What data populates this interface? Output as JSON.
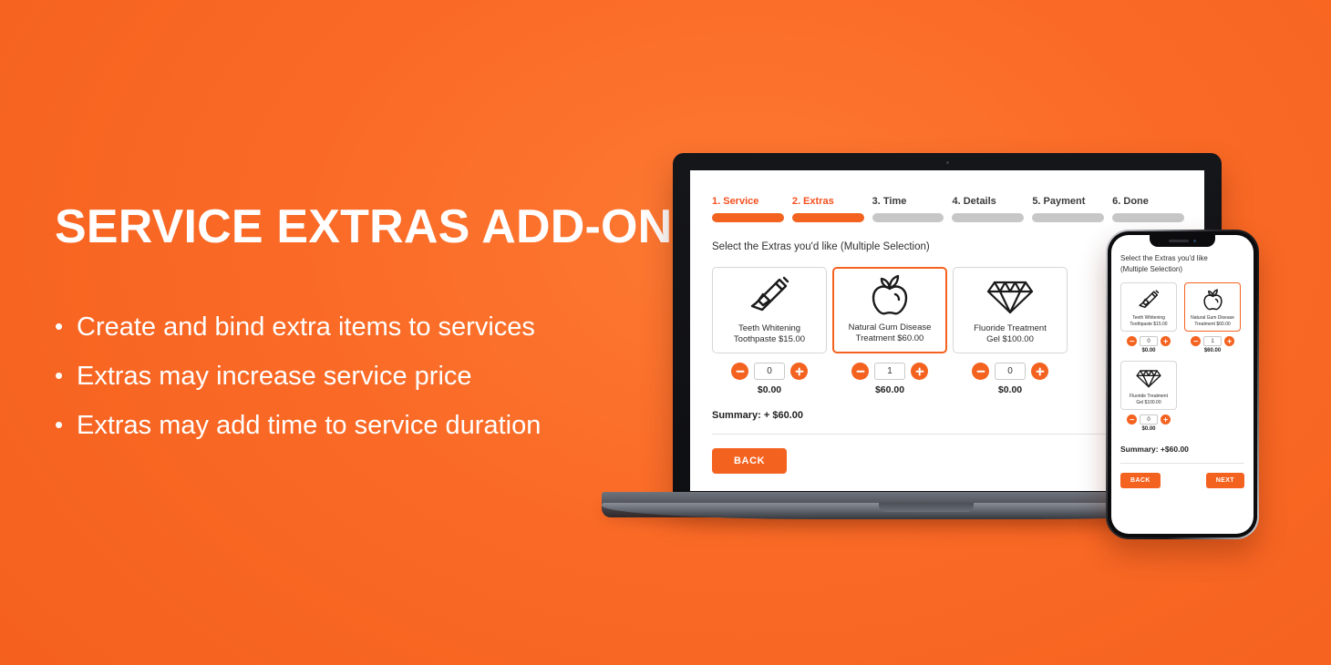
{
  "theme": {
    "background_orange": "#fa6522",
    "accent_orange": "#f4621f",
    "inactive_gray": "#c7c7c7",
    "text_dark": "#1f1f1f",
    "white": "#ffffff"
  },
  "hero": {
    "headline": "SERVICE EXTRAS ADD-ON",
    "bullet_marker": "•",
    "bullets": [
      "Create and bind extra items to services",
      "Extras may increase service price",
      "Extras may add time to service duration"
    ]
  },
  "booking": {
    "steps": [
      {
        "label": "1. Service",
        "active": true
      },
      {
        "label": "2. Extras",
        "active": true
      },
      {
        "label": "3. Time",
        "active": false
      },
      {
        "label": "4. Details",
        "active": false
      },
      {
        "label": "5. Payment",
        "active": false
      },
      {
        "label": "6. Done",
        "active": false
      }
    ],
    "prompt": "Select the Extras you'd like (Multiple Selection)",
    "prompt_mobile_line1": "Select the Extras you'd like",
    "prompt_mobile_line2": "(Multiple Selection)",
    "extras": [
      {
        "icon": "toothpaste-tube-icon",
        "label": "Teeth Whitening Toothpaste $15.00",
        "label_line1": "Teeth Whitening",
        "label_line2": "Toothpaste $15.00",
        "selected": false,
        "quantity": "0",
        "line_total": "$0.00"
      },
      {
        "icon": "apple-icon",
        "label": "Natural Gum Disease Treatment $60.00",
        "label_line1": "Natural Gum Disease",
        "label_line2": "Treatment $60.00",
        "selected": true,
        "quantity": "1",
        "line_total": "$60.00"
      },
      {
        "icon": "diamond-icon",
        "label": "Fluoride Treatment Gel $100.00",
        "label_line1": "Fluoride Treatment",
        "label_line2": "Gel $100.00",
        "selected": false,
        "quantity": "0",
        "line_total": "$0.00"
      }
    ],
    "summary_desktop": "Summary: + $60.00",
    "summary_mobile": "Summary: +$60.00",
    "back_button": "BACK",
    "next_button": "NEXT",
    "decrement_icon": "minus-circle-icon",
    "increment_icon": "plus-circle-icon"
  }
}
